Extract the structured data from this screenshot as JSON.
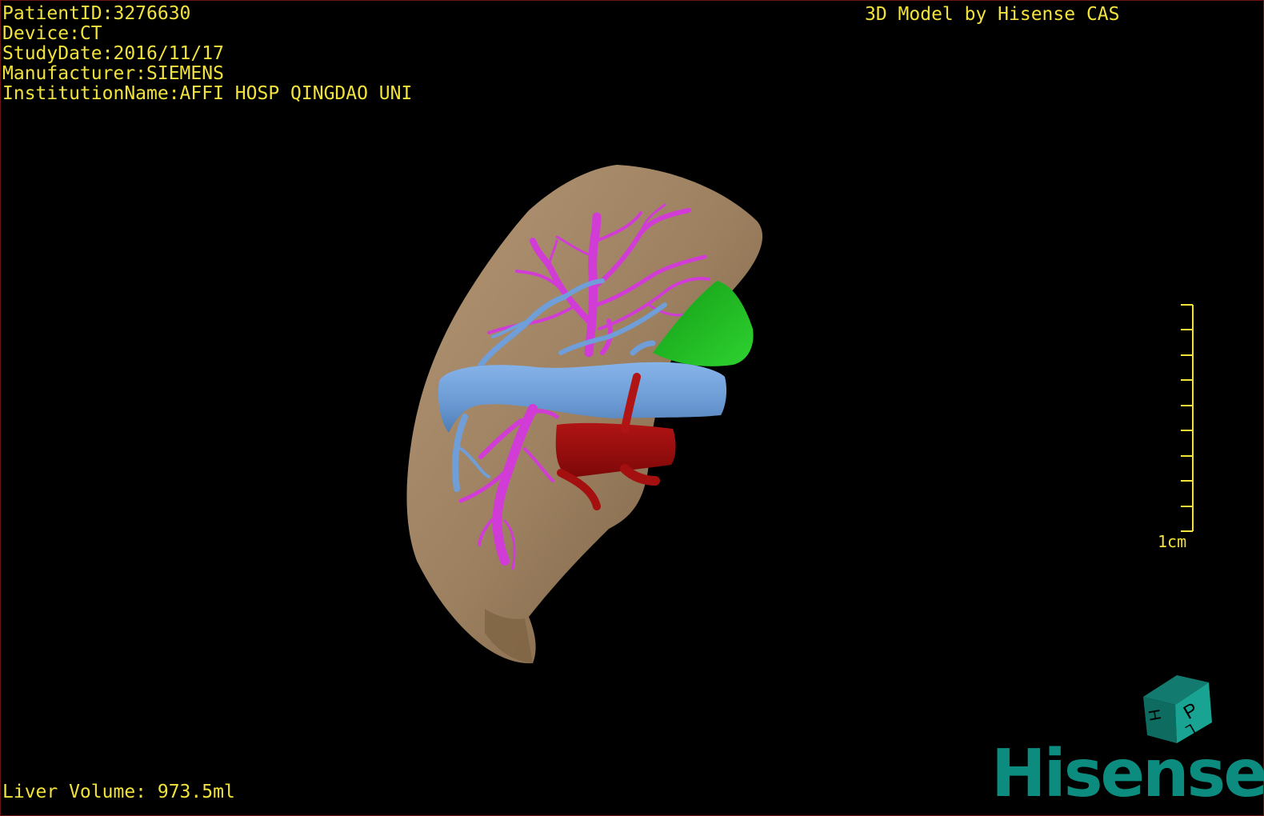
{
  "patient_info": {
    "patient_id": "PatientID:3276630",
    "device": "Device:CT",
    "study_date": "StudyDate:2016/11/17",
    "manufacturer": "Manufacturer:SIEMENS",
    "institution": "InstitutionName:AFFI HOSP QINGDAO UNI"
  },
  "header": {
    "title": "3D Model by Hisense CAS"
  },
  "footer": {
    "liver_volume": "Liver Volume: 973.5ml"
  },
  "scale_bar": {
    "label": "1cm",
    "tick_count": 10
  },
  "orientation_cube": {
    "faces": [
      "P",
      "H",
      "L"
    ]
  },
  "logo": {
    "text": "Hisense"
  },
  "colors": {
    "overlay_text": "#f2e23c",
    "liver": "#9c8060",
    "portal_vein": "#6f9ed8",
    "hepatic_vessels": "#d23cd6",
    "artery": "#9e0d0d",
    "gallbladder": "#22b424",
    "brand": "#0c8b7f"
  }
}
